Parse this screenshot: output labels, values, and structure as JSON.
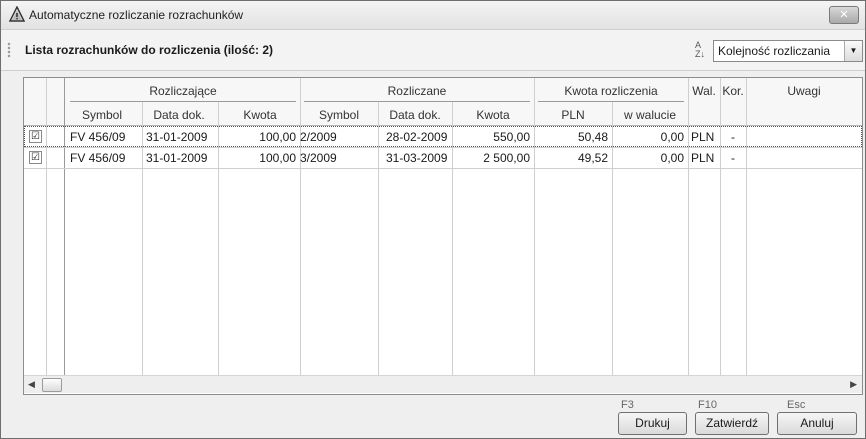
{
  "window": {
    "title": "Automatyczne rozliczanie rozrachunków",
    "close_icon": "close-icon"
  },
  "toolbar": {
    "list_title": "Lista rozrachunków do rozliczenia (ilość: 2)",
    "sort_icon": "sort-az-icon",
    "order_select": {
      "selected": "Kolejność rozliczania"
    }
  },
  "table": {
    "groups": {
      "rozliczajace": "Rozliczające",
      "rozliczane": "Rozliczane",
      "kwota_rozliczenia": "Kwota rozliczenia"
    },
    "columns": {
      "symbol1": "Symbol",
      "data1": "Data dok.",
      "kwota1": "Kwota",
      "symbol2": "Symbol",
      "data2": "Data dok.",
      "kwota2": "Kwota",
      "pln": "PLN",
      "w_walucie": "w walucie",
      "wal": "Wal.",
      "kor": "Kor.",
      "uwagi": "Uwagi"
    },
    "rows": [
      {
        "checked": "☑",
        "symbol1": "FV 456/09",
        "data1": "31-01-2009",
        "kwota1": "100,00",
        "symbol2": "2/2009",
        "data2": "28-02-2009",
        "kwota2": "550,00",
        "pln": "50,48",
        "w_walucie": "0,00",
        "wal": "PLN",
        "kor": "-",
        "uwagi": ""
      },
      {
        "checked": "☑",
        "symbol1": "FV 456/09",
        "data1": "31-01-2009",
        "kwota1": "100,00",
        "symbol2": "3/2009",
        "data2": "31-03-2009",
        "kwota2": "2 500,00",
        "pln": "49,52",
        "w_walucie": "0,00",
        "wal": "PLN",
        "kor": "-",
        "uwagi": ""
      }
    ]
  },
  "footer": {
    "print": {
      "shortcut": "F3",
      "label": "Drukuj"
    },
    "confirm": {
      "shortcut": "F10",
      "label": "Zatwierdź"
    },
    "cancel": {
      "shortcut": "Esc",
      "label": "Anuluj"
    }
  }
}
